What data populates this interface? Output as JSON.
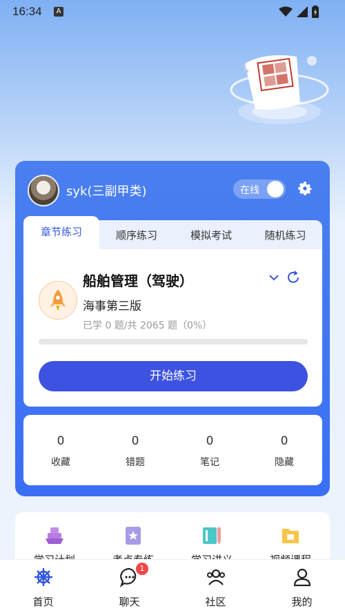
{
  "status_bar": {
    "time": "16:34",
    "notif_letter": "A"
  },
  "user": {
    "name": "syk(三副甲类)",
    "status_toggle_label": "在线",
    "status_on": true
  },
  "tabs": [
    {
      "label": "章节练习",
      "active": true
    },
    {
      "label": "顺序练习",
      "active": false
    },
    {
      "label": "模拟考试",
      "active": false
    },
    {
      "label": "随机练习",
      "active": false
    }
  ],
  "subject": {
    "title": "船舶管理（驾驶）",
    "edition": "海事第三版",
    "progress_text": "已学 0 题/共 2065 题（0%）",
    "progress_fraction": 0,
    "start_label": "开始练习"
  },
  "stats": [
    {
      "value": "0",
      "label": "收藏"
    },
    {
      "value": "0",
      "label": "错题"
    },
    {
      "value": "0",
      "label": "笔记"
    },
    {
      "value": "0",
      "label": "隐藏"
    }
  ],
  "features": [
    {
      "label": "学习计划",
      "icon": "ship-plan-icon"
    },
    {
      "label": "考点专练",
      "icon": "star-doc-icon"
    },
    {
      "label": "学习讲义",
      "icon": "book-pen-icon"
    },
    {
      "label": "视频课程",
      "icon": "folder-icon"
    }
  ],
  "nav": [
    {
      "label": "首页",
      "icon": "helm-icon",
      "active": true
    },
    {
      "label": "聊天",
      "icon": "chat-icon",
      "badge": "1"
    },
    {
      "label": "社区",
      "icon": "community-icon"
    },
    {
      "label": "我的",
      "icon": "profile-icon"
    }
  ],
  "colors": {
    "primary": "#3a6ff5",
    "button": "#3d52e0",
    "badge": "#f04848",
    "tab_active": "#3355e0"
  }
}
